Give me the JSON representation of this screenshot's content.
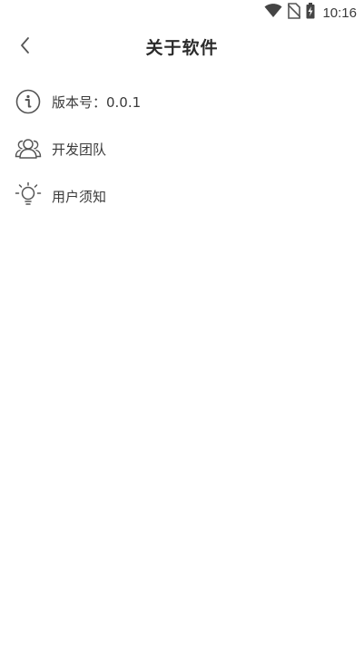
{
  "status_bar": {
    "time": "10:16",
    "icons": [
      "wifi-icon",
      "no-sim-icon",
      "battery-charging-icon"
    ]
  },
  "header": {
    "title": "关于软件",
    "back_icon": "chevron-left-icon"
  },
  "menu": {
    "items": [
      {
        "icon": "info-icon",
        "label": "版本号：0.0.1"
      },
      {
        "icon": "team-icon",
        "label": "开发团队"
      },
      {
        "icon": "lightbulb-icon",
        "label": "用户须知"
      }
    ]
  },
  "colors": {
    "background": "#ffffff",
    "text": "#333333",
    "icon": "#555555"
  }
}
